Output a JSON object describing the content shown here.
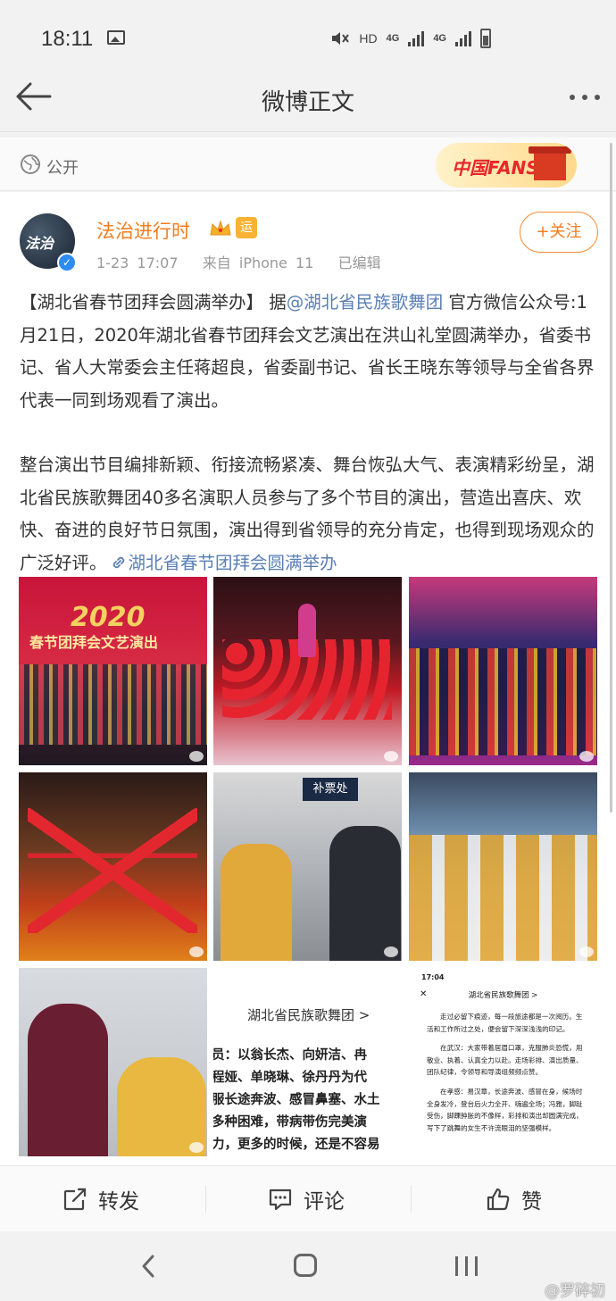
{
  "status_bar": {
    "time": "18:11",
    "hd": "HD",
    "net1": "4G",
    "net2": "4G"
  },
  "nav": {
    "title": "微博正文"
  },
  "visibility": {
    "label": "公开",
    "badge": "中国FANS"
  },
  "author": {
    "name": "法治进行时",
    "avatar_text": "法治",
    "yun_badge": "运",
    "time": "1-23 17:07",
    "source": "来自 iPhone 11",
    "edited": "已编辑",
    "follow_label": "+关注",
    "name_color": "#f47c1e",
    "verified_color": "#2d8cf0"
  },
  "post": {
    "p1_a": "【湖北省春节团拜会圆满举办】 据",
    "p1_mention": "@湖北省民族歌舞团",
    "p1_b": " 官方微信公众号:1月21日，2020年湖北省春节团拜会文艺演出在洪山礼堂圆满举办，省委书记、省人大常委会主任蒋超良，省委副书记、省长王晓东等领导与全省各界代表一同到场观看了演出。",
    "p2": "整台演出节目编排新颖、衔接流畅紧凑、舞台恢弘大气、表演精彩纷呈，湖北省民族歌舞团40多名演职人员参与了多个节目的演出，营造出喜庆、欢快、奋进的良好节日氛围，演出得到省领导的充分肯定，也得到现场观众的广泛好评。",
    "link": "湖北省春节团拜会圆满举办",
    "link_color": "#5a7fb5"
  },
  "photos": {
    "p1_title": "2020",
    "p1_sub": "春节团拜会文艺演出",
    "p5_sign": "补票处",
    "p8_title": "湖北省民族歌舞团 >",
    "p8_lines": [
      "员：以翁长杰、向妍洁、冉",
      "程娅、单晓琳、徐丹丹为代",
      "服长途奔波、感冒鼻塞、水土",
      "多种困难，带病带伤完美演",
      "力，更多的时候，还是不容易"
    ],
    "p9_time": "17:04",
    "p9_title": "湖北省民族歌舞团 >",
    "p9_para1": "走过必留下痕迹，每一段旅途都是一次阅历。生活和工作所过之处，便会留下深深浅浅的印记。",
    "p9_para2": "在武汉：大家带着居眉口罩，克服肺炎恐慌，用敬业、执着、认真全力以赴。走场彩排、演出质量、团队纪律，令领导和导演组频频点赞。",
    "p9_para3": "在孝感：易汉章，长途奔波、感冒在身，候场时全身发冷，登台后火力全开、嗨遍全场；冯雅，脚趾受伤，脚踝肿胀的不像样，彩排和演出却圆满完成，写下了跳舞的女生不许流眼泪的坚强模样。"
  },
  "actions": {
    "repost": "转发",
    "comment": "评论",
    "like": "赞"
  },
  "watermark": "@罗碎初"
}
